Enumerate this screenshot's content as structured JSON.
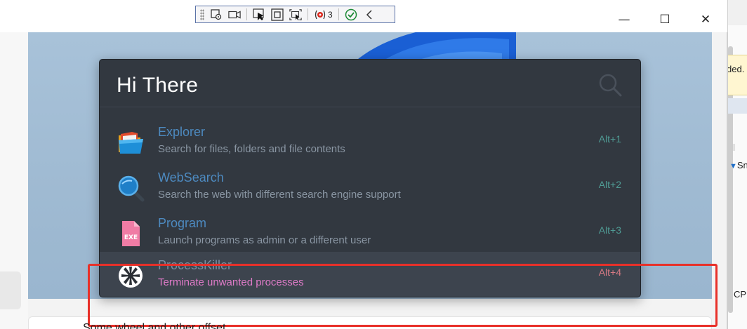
{
  "debug_toolbar": {
    "breakpoint_count": "3",
    "icons": [
      "gripper-icon",
      "select-element-icon",
      "record-video-icon",
      "pointer-select-icon",
      "window-select-icon",
      "region-select-icon",
      "breakpoint-icon",
      "checkmark-icon",
      "collapse-chevron-icon"
    ]
  },
  "host_window": {
    "minimize_symbol": "—",
    "maximize_symbol": "☐",
    "close_symbol": "✕",
    "bottom_text": "Some wheel and other offset..."
  },
  "right_window": {
    "text_partial": "ded.",
    "dropdown_partial": "Sn",
    "label_partial": "CPU"
  },
  "launcher": {
    "search_text": "Hi There",
    "results": [
      {
        "title": "Explorer",
        "subtitle": "Search for files, folders and file contents",
        "hotkey": "Alt+1",
        "icon": "folder-icon"
      },
      {
        "title": "WebSearch",
        "subtitle": "Search the web with different search engine support",
        "hotkey": "Alt+2",
        "icon": "magnifier-globe-icon"
      },
      {
        "title": "Program",
        "subtitle": "Launch programs as admin or a different user",
        "hotkey": "Alt+3",
        "icon": "exe-file-icon",
        "icon_text": "EXE"
      },
      {
        "title": "ProcessKiller",
        "subtitle": "Terminate unwanted processes",
        "hotkey": "Alt+4",
        "icon": "process-killer-icon",
        "selected": true
      }
    ]
  },
  "colors": {
    "launcher_bg": "#323840",
    "title_blue": "#4d8ac0",
    "hotkey_teal": "#4f9b94",
    "selected_subtitle_pink": "#e07bc9",
    "annotation_red": "#e83029"
  }
}
